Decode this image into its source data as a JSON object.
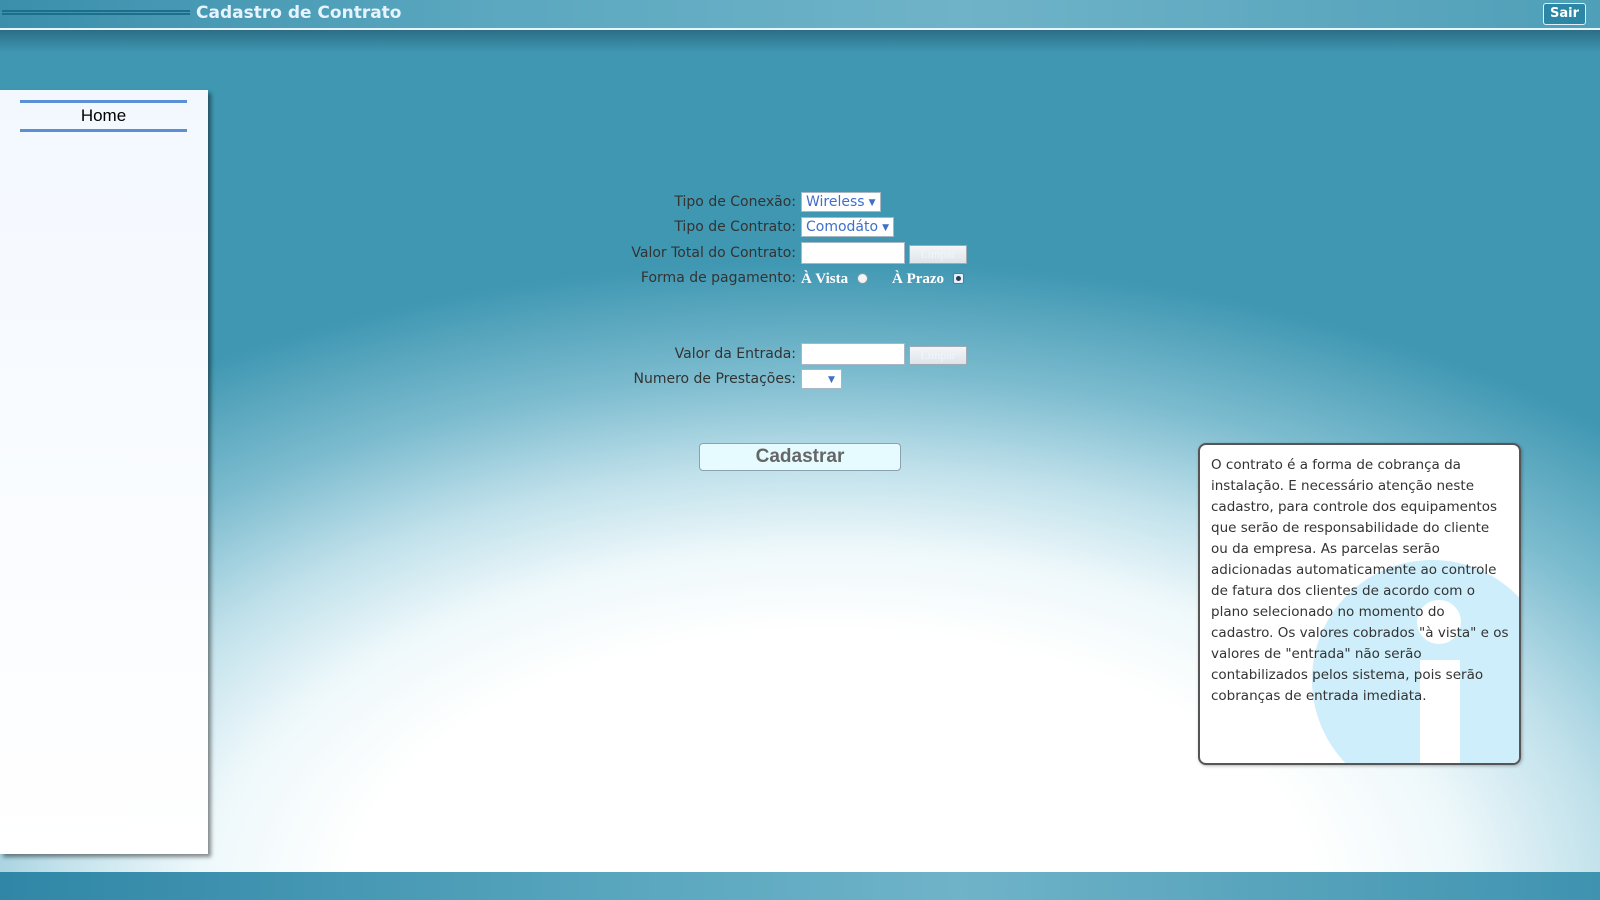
{
  "header": {
    "title": "Cadastro de Contrato",
    "logout_label": "Sair"
  },
  "sidebar": {
    "items": [
      {
        "label": "Home"
      }
    ]
  },
  "form": {
    "connection_type": {
      "label": "Tipo de Conexão:",
      "value": "Wireless"
    },
    "contract_type": {
      "label": "Tipo de Contrato:",
      "value": "Comodáto"
    },
    "total_value": {
      "label": "Valor Total do Contrato:",
      "value": "",
      "clear_label": "Limpar"
    },
    "payment_method": {
      "label": "Forma de pagamento:",
      "options": [
        {
          "label": "À Vista",
          "checked": false
        },
        {
          "label": "À Prazo",
          "checked": true
        }
      ]
    },
    "down_payment": {
      "label": "Valor da Entrada:",
      "value": "",
      "clear_label": "Limpar"
    },
    "installments": {
      "label": "Numero de Prestações:",
      "value": ""
    },
    "submit_label": "Cadastrar"
  },
  "info": {
    "text": "O contrato é a forma de cobrança da instalação. E necessário atenção neste cadastro, para controle dos equipamentos que serão de responsabilidade do cliente ou da empresa. As parcelas serão adicionadas automaticamente ao controle de fatura dos clientes de acordo com o plano selecionado no momento do cadastro. Os valores cobrados \"à vista\" e os valores de \"entrada\" não serão contabilizados pelos sistema, pois serão cobranças de entrada imediata.",
    "icon": "info-icon"
  },
  "colors": {
    "accent": "#3f6fc9",
    "header": "#4f9fb8"
  }
}
